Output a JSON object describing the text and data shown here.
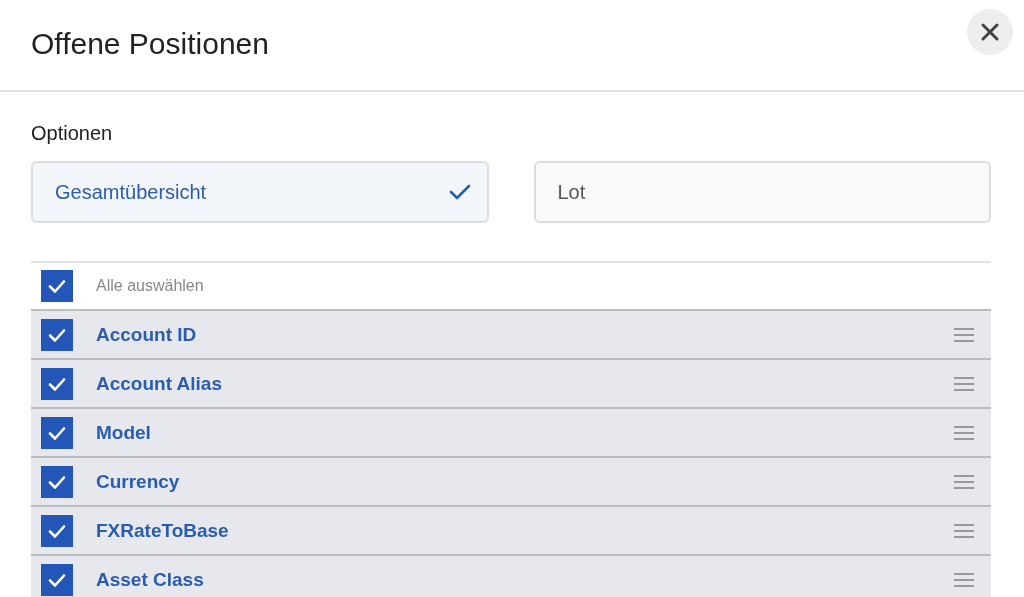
{
  "dialog": {
    "title": "Offene Positionen"
  },
  "options": {
    "label": "Optionen",
    "choices": [
      {
        "label": "Gesamtübersicht",
        "selected": true
      },
      {
        "label": "Lot",
        "selected": false
      }
    ]
  },
  "select_all": {
    "label": "Alle auswählen",
    "checked": true
  },
  "columns": [
    {
      "label": "Account ID",
      "checked": true
    },
    {
      "label": "Account Alias",
      "checked": true
    },
    {
      "label": "Model",
      "checked": true
    },
    {
      "label": "Currency",
      "checked": true
    },
    {
      "label": "FXRateToBase",
      "checked": true
    },
    {
      "label": "Asset Class",
      "checked": true
    }
  ]
}
